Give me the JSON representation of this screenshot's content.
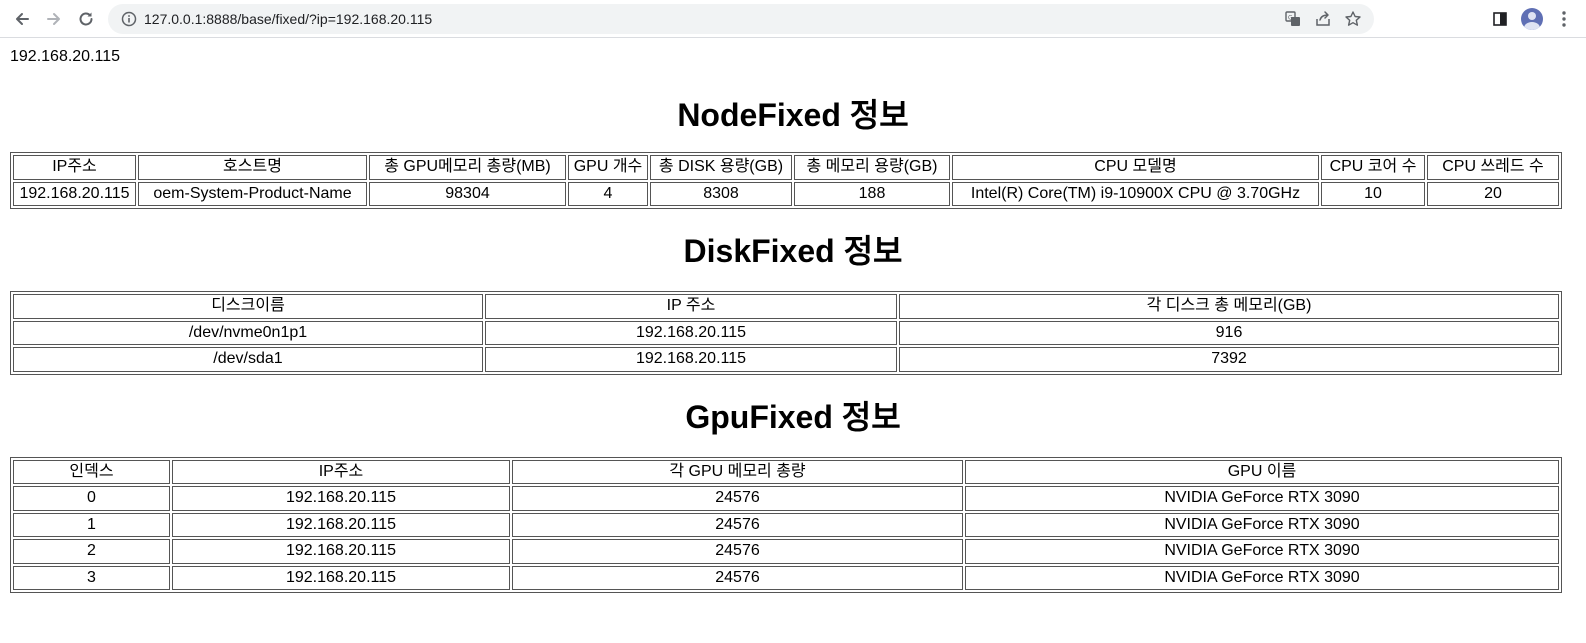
{
  "browser": {
    "url": "127.0.0.1:8888/base/fixed/?ip=192.168.20.115"
  },
  "page": {
    "ip_heading": "192.168.20.115"
  },
  "node": {
    "title": "NodeFixed 정보",
    "headers": [
      "IP주소",
      "호스트명",
      "총 GPU메모리 총량(MB)",
      "GPU 개수",
      "총 DISK 용량(GB)",
      "총 메모리 용량(GB)",
      "CPU 모델명",
      "CPU 코어 수",
      "CPU 쓰레드 수"
    ],
    "rows": [
      [
        "192.168.20.115",
        "oem-System-Product-Name",
        "98304",
        "4",
        "8308",
        "188",
        "Intel(R) Core(TM) i9-10900X CPU @ 3.70GHz",
        "10",
        "20"
      ]
    ]
  },
  "disk": {
    "title": "DiskFixed 정보",
    "headers": [
      "디스크이름",
      "IP 주소",
      "각 디스크 총 메모리(GB)"
    ],
    "rows": [
      [
        "/dev/nvme0n1p1",
        "192.168.20.115",
        "916"
      ],
      [
        "/dev/sda1",
        "192.168.20.115",
        "7392"
      ]
    ]
  },
  "gpu": {
    "title": "GpuFixed 정보",
    "headers": [
      "인덱스",
      "IP주소",
      "각 GPU 메모리 총량",
      "GPU 이름"
    ],
    "rows": [
      [
        "0",
        "192.168.20.115",
        "24576",
        "NVIDIA GeForce RTX 3090"
      ],
      [
        "1",
        "192.168.20.115",
        "24576",
        "NVIDIA GeForce RTX 3090"
      ],
      [
        "2",
        "192.168.20.115",
        "24576",
        "NVIDIA GeForce RTX 3090"
      ],
      [
        "3",
        "192.168.20.115",
        "24576",
        "NVIDIA GeForce RTX 3090"
      ]
    ]
  }
}
